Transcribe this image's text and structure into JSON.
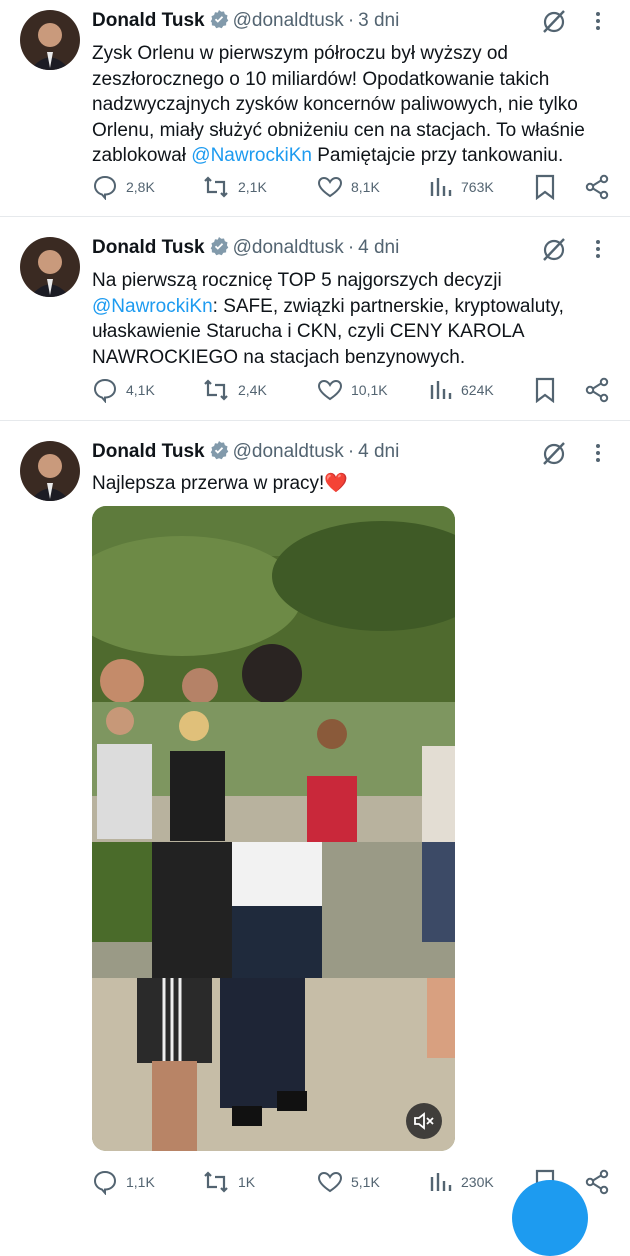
{
  "tweets": [
    {
      "author": "Donald Tusk",
      "handle": "@donaldtusk",
      "time": "3 dni",
      "text_before": "Zysk Orlenu w pierwszym półroczu był wyższy od zeszłorocznego o 10 miliardów! Opodatkowanie takich nadzwyczajnych zysków koncernów paliwowych, nie tylko Orlenu, miały służyć obniżeniu cen na stacjach. To właśnie zablokował ",
      "mention": "@NawrockiKn",
      "text_after": "  Pamiętajcie przy tankowaniu.",
      "replies": "2,8K",
      "reposts": "2,1K",
      "likes": "8,1K",
      "views": "763K"
    },
    {
      "author": "Donald Tusk",
      "handle": "@donaldtusk",
      "time": "4 dni",
      "text_before": "Na pierwszą rocznicę TOP 5 najgorszych decyzji ",
      "mention": "@NawrockiKn",
      "text_after": ": SAFE, związki partnerskie, kryptowaluty, ułaskawienie Staruchа i CKN, czyli CENY KAROLA NAWROCKIEGO na stacjach benzynowych.",
      "replies": "4,1K",
      "reposts": "2,4K",
      "likes": "10,1K",
      "views": "624K"
    },
    {
      "author": "Donald Tusk",
      "handle": "@donaldtusk",
      "time": "4 dni",
      "text": "Najlepsza przerwa w pracy!",
      "emoji": "❤️",
      "replies": "1,1K",
      "reposts": "1K",
      "likes": "5,1K",
      "views": "230K"
    }
  ],
  "separator": "·",
  "colors": {
    "accent": "#1d9bf0",
    "secondary_text": "#536471",
    "divider": "#e6e9ec"
  },
  "icons": [
    "verified-badge-icon",
    "grok-icon",
    "more-icon",
    "reply-icon",
    "repost-icon",
    "like-icon",
    "views-icon",
    "bookmark-icon",
    "share-icon",
    "mute-icon",
    "compose-icon"
  ]
}
